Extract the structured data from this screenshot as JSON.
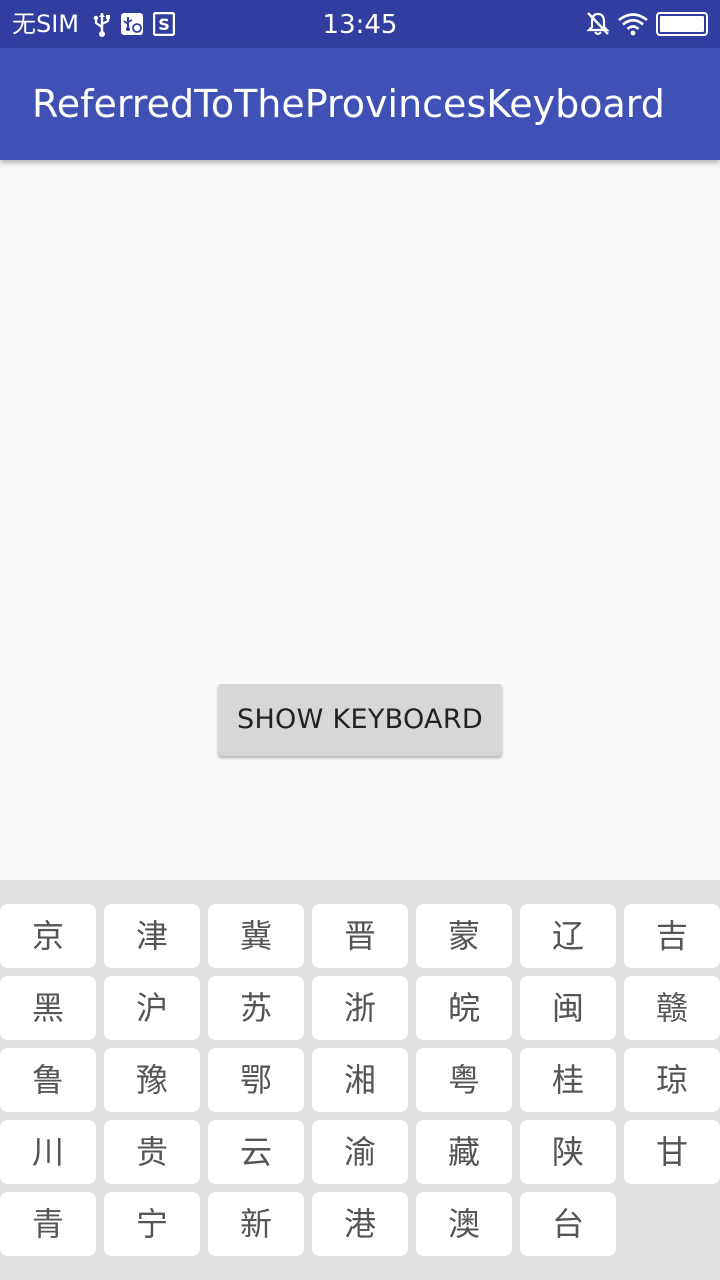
{
  "status_bar": {
    "carrier": "无SIM",
    "time": "13:45",
    "icons": [
      "usb-icon",
      "usb-debug-icon",
      "s-app-icon",
      "silent-icon",
      "wifi-icon",
      "battery-icon"
    ]
  },
  "app_bar": {
    "title": "ReferredToTheProvincesKeyboard"
  },
  "main": {
    "show_keyboard_label": "SHOW KEYBOARD"
  },
  "keyboard": {
    "rows": [
      [
        "京",
        "津",
        "冀",
        "晋",
        "蒙",
        "辽",
        "吉"
      ],
      [
        "黑",
        "沪",
        "苏",
        "浙",
        "皖",
        "闽",
        "赣"
      ],
      [
        "鲁",
        "豫",
        "鄂",
        "湘",
        "粤",
        "桂",
        "琼"
      ],
      [
        "川",
        "贵",
        "云",
        "渝",
        "藏",
        "陕",
        "甘"
      ],
      [
        "青",
        "宁",
        "新",
        "港",
        "澳",
        "台"
      ]
    ]
  },
  "colors": {
    "status_bar": "#303f9f",
    "app_bar": "#3f51b5",
    "background": "#fafafa",
    "keyboard_background": "#e2e2e2",
    "key_background": "#ffffff",
    "key_text": "#555555",
    "button_background": "#d6d7d7"
  }
}
